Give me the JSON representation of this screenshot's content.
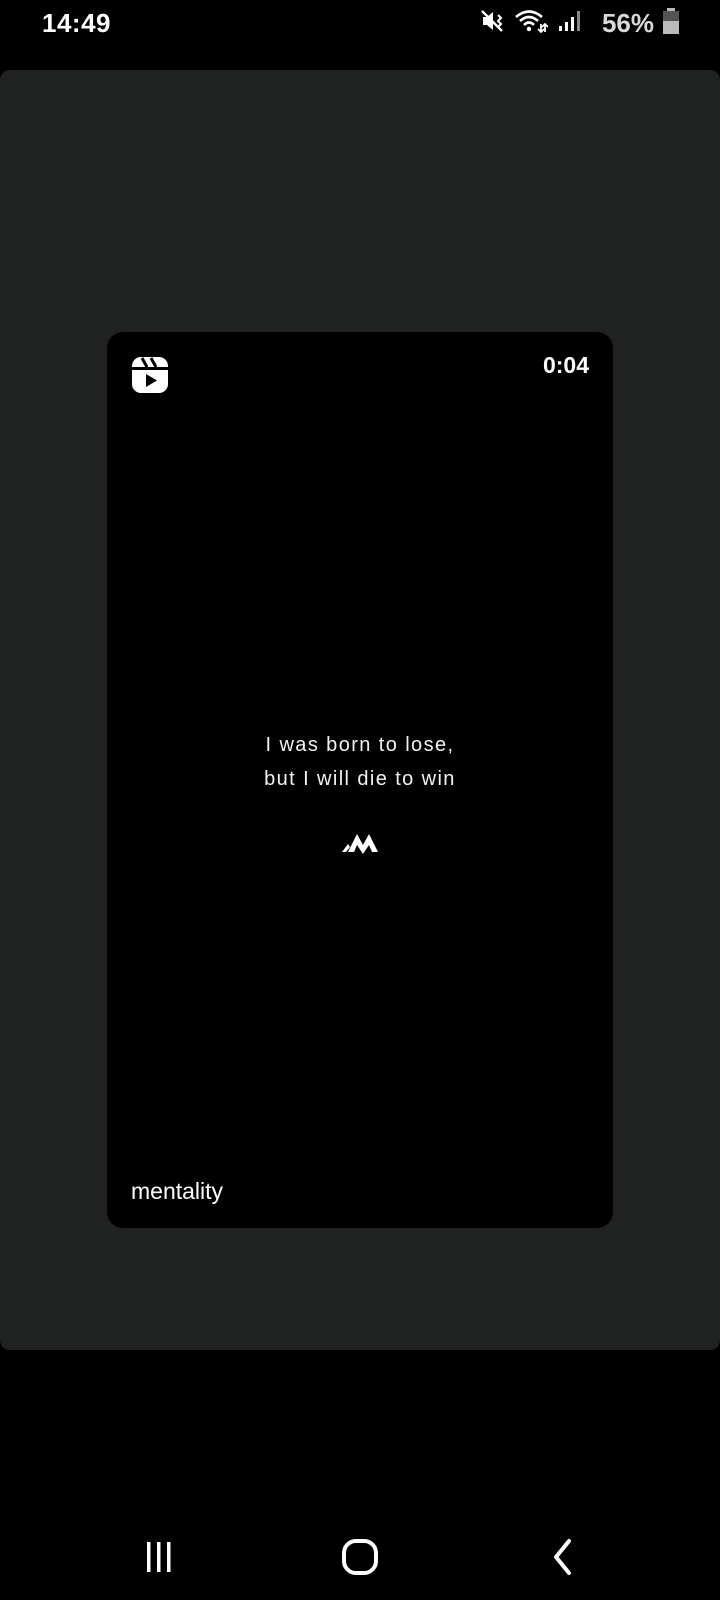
{
  "status_bar": {
    "time": "14:49",
    "battery": "56%",
    "icons": [
      "mute-vibrate-icon",
      "wifi-icon",
      "signal-icon",
      "battery-icon"
    ]
  },
  "reel_card": {
    "icon": "reels-icon",
    "duration": "0:04",
    "quote_line_1": "I was born to lose,",
    "quote_line_2": "but I will die to win",
    "logo": "mentality-logo",
    "username": "mentality"
  },
  "nav_bar": {
    "buttons": [
      "recent-apps",
      "home",
      "back"
    ]
  },
  "colors": {
    "background": "#000000",
    "panel": "#202221",
    "text": "#ffffff"
  }
}
